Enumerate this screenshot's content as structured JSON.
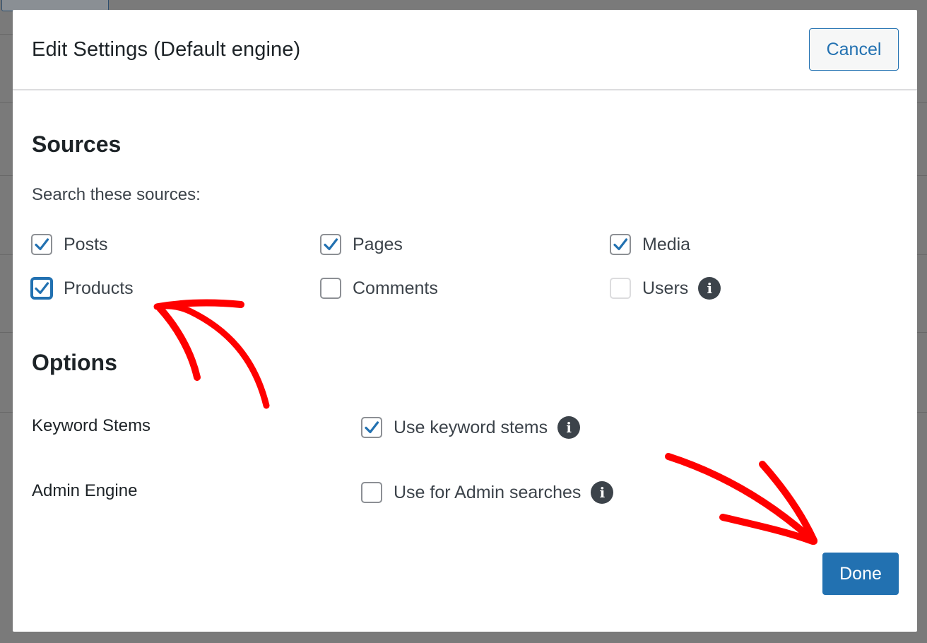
{
  "modal": {
    "title": "Edit Settings (Default engine)",
    "cancel_label": "Cancel",
    "done_label": "Done"
  },
  "sources": {
    "heading": "Sources",
    "subtext": "Search these sources:",
    "items": [
      {
        "label": "Posts",
        "checked": true
      },
      {
        "label": "Pages",
        "checked": true
      },
      {
        "label": "Media",
        "checked": true
      },
      {
        "label": "Products",
        "checked": true
      },
      {
        "label": "Comments",
        "checked": false
      },
      {
        "label": "Users",
        "checked": false
      }
    ]
  },
  "options": {
    "heading": "Options",
    "keyword_stems": {
      "label": "Keyword Stems",
      "checkbox_label": "Use keyword stems",
      "checked": true
    },
    "admin_engine": {
      "label": "Admin Engine",
      "checkbox_label": "Use for Admin searches",
      "checked": false
    }
  },
  "colors": {
    "accent": "#2271b1",
    "annotation": "#ff0000",
    "overlay": "#7a7a7a"
  },
  "icons": [
    "info-icon",
    "check-icon",
    "arrow-annotation"
  ]
}
